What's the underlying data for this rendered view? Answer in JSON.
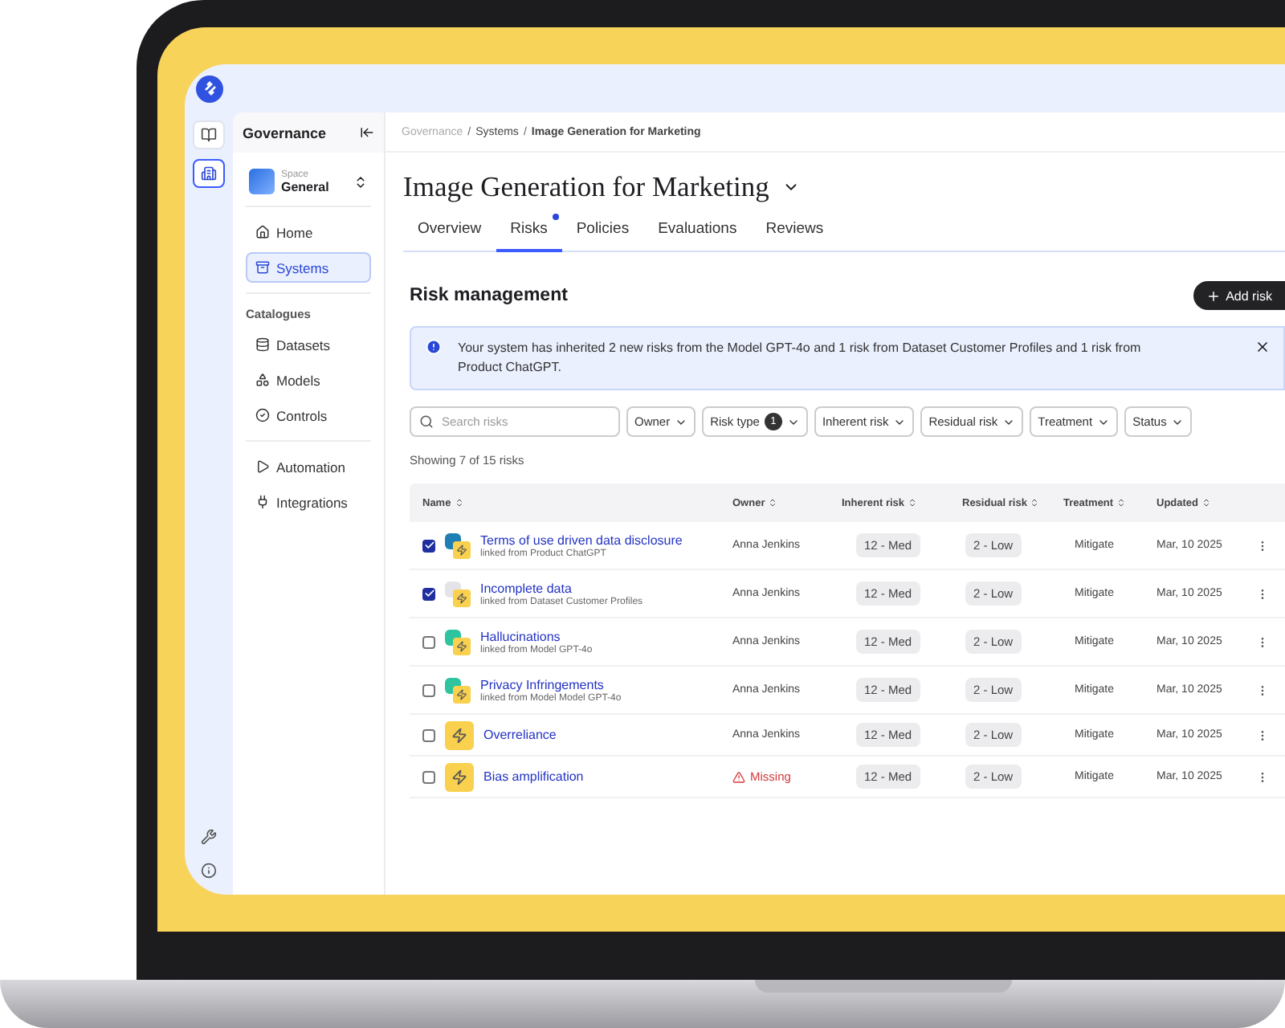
{
  "rail": {
    "top": [
      {
        "kind": "book",
        "selected": false
      },
      {
        "kind": "building",
        "selected": true
      }
    ],
    "bottom": [
      {
        "kind": "tools"
      },
      {
        "kind": "info"
      }
    ]
  },
  "sidebar": {
    "title": "Governance",
    "space_label": "Space",
    "space_name": "General",
    "groups": [
      {
        "items": [
          {
            "label": "Home",
            "selected": false
          },
          {
            "label": "Systems",
            "selected": true
          }
        ]
      },
      {
        "heading": "Catalogues",
        "items": [
          {
            "label": "Datasets",
            "selected": false
          },
          {
            "label": "Models",
            "selected": false
          },
          {
            "label": "Controls",
            "selected": false
          }
        ]
      },
      {
        "items": [
          {
            "label": "Automation",
            "selected": false
          },
          {
            "label": "Integrations",
            "selected": false
          }
        ]
      }
    ]
  },
  "breadcrumb": {
    "separator": "/",
    "items": [
      "Governance",
      "Systems",
      "Image Generation for Marketing"
    ]
  },
  "title": "Image Generation for Marketing",
  "tabs": [
    {
      "label": "Overview",
      "selected": false,
      "dot": false
    },
    {
      "label": "Risks",
      "selected": true,
      "dot": true
    },
    {
      "label": "Policies",
      "selected": false,
      "dot": false
    },
    {
      "label": "Evaluations",
      "selected": false,
      "dot": false
    },
    {
      "label": "Reviews",
      "selected": false,
      "dot": false
    }
  ],
  "section_title": "Risk management",
  "add_button": "Add risk",
  "alert": "Your system has inherited 2 new risks from the Model GPT-4o and 1 risk from Dataset Customer Profiles and 1 risk from Product ChatGPT.",
  "search": {
    "placeholder": "Search risks"
  },
  "filters": [
    {
      "label": "Owner"
    },
    {
      "label": "Risk type",
      "count": "1"
    },
    {
      "label": "Inherent risk"
    },
    {
      "label": "Residual risk"
    },
    {
      "label": "Treatment"
    },
    {
      "label": "Status"
    }
  ],
  "showing": "Showing 7 of 15 risks",
  "columns": [
    "Name",
    "Owner",
    "Inherent risk",
    "Residual risk",
    "Treatment",
    "Updated"
  ],
  "rows": [
    {
      "checked": true,
      "kind": "linked",
      "color": "#1f7fb5",
      "name": "Terms of use driven data disclosure",
      "source": "linked from Product ChatGPT",
      "owner_missing": false,
      "owner": "Anna Jenkins",
      "inherent": "12 - Med",
      "residual": "2 - Low",
      "treatment": "Mitigate",
      "updated": "Mar, 10 2025"
    },
    {
      "checked": true,
      "kind": "linked",
      "color": "#e4e4e8",
      "name": "Incomplete data",
      "source": "linked from Dataset Customer Profiles",
      "owner_missing": false,
      "owner": "Anna Jenkins",
      "inherent": "12 - Med",
      "residual": "2 - Low",
      "treatment": "Mitigate",
      "updated": "Mar, 10 2025"
    },
    {
      "checked": false,
      "kind": "linked",
      "color": "#2ec4a0",
      "name": "Hallucinations",
      "source": "linked from Model GPT-4o",
      "owner_missing": false,
      "owner": "Anna Jenkins",
      "inherent": "12 - Med",
      "residual": "2 - Low",
      "treatment": "Mitigate",
      "updated": "Mar, 10 2025"
    },
    {
      "checked": false,
      "kind": "linked",
      "color": "#2ec4a0",
      "name": "Privacy Infringements",
      "source": "linked from Model Model GPT-4o",
      "owner_missing": false,
      "owner": "Anna Jenkins",
      "inherent": "12 - Med",
      "residual": "2 - Low",
      "treatment": "Mitigate",
      "updated": "Mar, 10 2025"
    },
    {
      "checked": false,
      "kind": "plain",
      "name": "Overreliance",
      "owner_missing": false,
      "owner": "Anna Jenkins",
      "inherent": "12 - Med",
      "residual": "2 - Low",
      "treatment": "Mitigate",
      "updated": "Mar, 10 2025"
    },
    {
      "checked": false,
      "kind": "plain",
      "name": "Bias amplification",
      "owner_missing": true,
      "owner": "Missing",
      "inherent": "12 - Med",
      "residual": "2 - Low",
      "treatment": "Mitigate",
      "updated": "Mar, 10 2025"
    }
  ]
}
